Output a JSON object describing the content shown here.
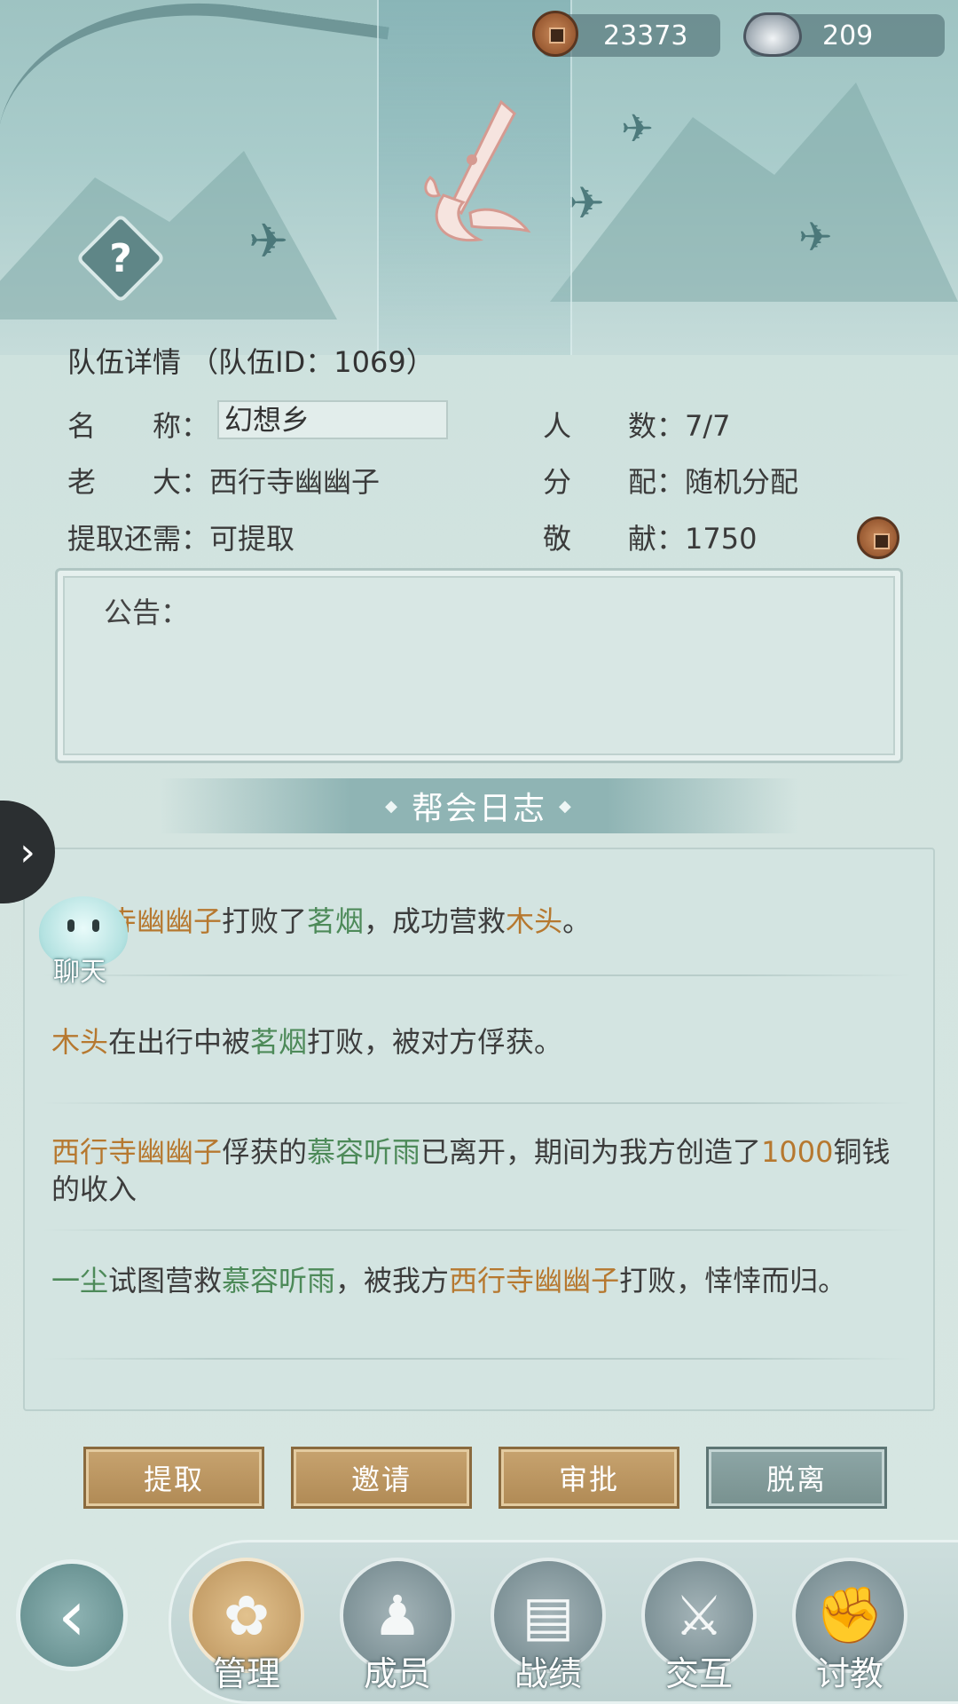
{
  "currency": {
    "coins": "23373",
    "silver": "209"
  },
  "team": {
    "title": "队伍详情 （队伍ID：1069）",
    "name_label": "名　　称：",
    "name_value": "幻想乡",
    "members_label": "人　　数：",
    "members_value": "7/7",
    "leader_label": "老　　大：",
    "leader_value": "西行寺幽幽子",
    "distribution_label": "分　　配：",
    "distribution_value": "随机分配",
    "withdraw_label": "提取还需：",
    "withdraw_value": "可提取",
    "contribution_label": "敬　　献：",
    "contribution_value": "1750"
  },
  "notice": {
    "label": "公告："
  },
  "log": {
    "title": "帮会日志",
    "entries": [
      {
        "parts": [
          {
            "text": "西行寺幽幽子",
            "color": "orange"
          },
          {
            "text": "打败了",
            "color": "plain"
          },
          {
            "text": "茗烟",
            "color": "green"
          },
          {
            "text": "，成功营救",
            "color": "plain"
          },
          {
            "text": "木头",
            "color": "orange"
          },
          {
            "text": "。",
            "color": "plain"
          }
        ]
      },
      {
        "parts": [
          {
            "text": "木头",
            "color": "orange"
          },
          {
            "text": "在出行中被",
            "color": "plain"
          },
          {
            "text": "茗烟",
            "color": "green"
          },
          {
            "text": "打败，被对方俘获。",
            "color": "plain"
          }
        ]
      },
      {
        "parts": [
          {
            "text": "西行寺幽幽子",
            "color": "orange"
          },
          {
            "text": "俘获的",
            "color": "plain"
          },
          {
            "text": "慕容听雨",
            "color": "green"
          },
          {
            "text": "已离开，期间为我方创造了",
            "color": "plain"
          },
          {
            "text": "1000",
            "color": "orange"
          },
          {
            "text": "铜钱的收入",
            "color": "plain"
          }
        ]
      },
      {
        "parts": [
          {
            "text": "一尘",
            "color": "green"
          },
          {
            "text": "试图营救",
            "color": "plain"
          },
          {
            "text": "慕容听雨",
            "color": "green"
          },
          {
            "text": "，被我方",
            "color": "plain"
          },
          {
            "text": "西行寺幽幽子",
            "color": "orange"
          },
          {
            "text": "打败，悻悻而归。",
            "color": "plain"
          }
        ]
      }
    ]
  },
  "chat": {
    "label": "聊天"
  },
  "actions": {
    "withdraw": "提取",
    "invite": "邀请",
    "approve": "审批",
    "leave": "脱离"
  },
  "nav": {
    "manage": "管理",
    "members": "成员",
    "record": "战绩",
    "interact": "交互",
    "learn": "讨教"
  },
  "colors": {
    "orange_name": "#b6782f",
    "green_name": "#4d8a59",
    "gold_button": "#c7a36f",
    "teal_button": "#8da6a6"
  }
}
